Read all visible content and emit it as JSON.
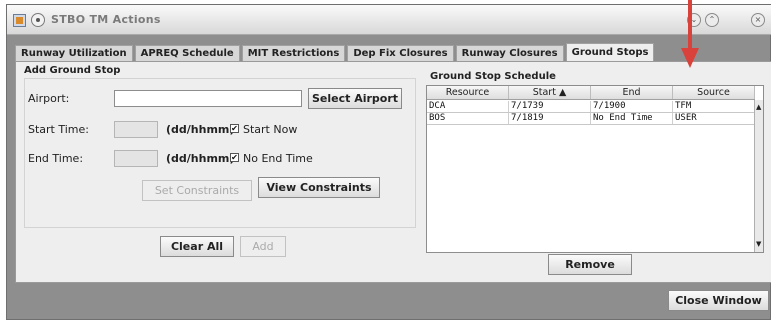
{
  "window": {
    "title": "STBO TM Actions"
  },
  "tabs": [
    {
      "label": "Runway Utilization"
    },
    {
      "label": "APREQ Schedule"
    },
    {
      "label": "MIT Restrictions"
    },
    {
      "label": "Dep Fix Closures"
    },
    {
      "label": "Runway Closures"
    },
    {
      "label": "Ground Stops",
      "active": true
    }
  ],
  "add_ground_stop": {
    "title": "Add Ground Stop",
    "airport_label": "Airport:",
    "airport_value": "",
    "select_airport": "Select Airport",
    "start_label": "Start Time:",
    "start_value": "",
    "start_format": "(dd/hhmm)",
    "start_now_label": "Start Now",
    "start_now_checked": true,
    "end_label": "End Time:",
    "end_value": "",
    "end_format": "(dd/hhmm)",
    "no_end_label": "No End Time",
    "no_end_checked": true,
    "set_constraints": "Set Constraints",
    "view_constraints": "View Constraints",
    "clear_all": "Clear All",
    "add": "Add"
  },
  "schedule": {
    "title": "Ground Stop Schedule",
    "columns": [
      "Resource",
      "Start ▲",
      "End",
      "Source"
    ],
    "rows": [
      [
        "DCA",
        "7/1739",
        "7/1900",
        "TFM"
      ],
      [
        "BOS",
        "7/1819",
        "No End Time",
        "USER"
      ]
    ],
    "remove": "Remove"
  },
  "footer": {
    "close_window": "Close Window"
  },
  "colors": {
    "annotation_arrow": "#d9423a"
  }
}
